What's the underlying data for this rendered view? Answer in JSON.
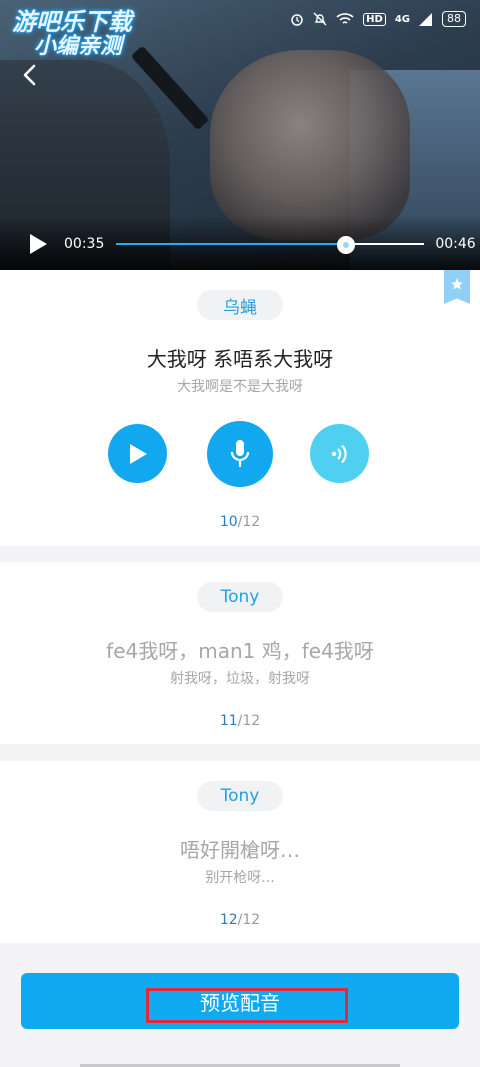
{
  "watermark": {
    "line1": "游吧乐下载",
    "line2": "小编亲测"
  },
  "status": {
    "hd": "HD",
    "network": "4G",
    "battery": "88"
  },
  "video": {
    "current_time": "00:35",
    "total_time": "00:46",
    "progress": 0.746
  },
  "lines": [
    {
      "role": "乌蝇",
      "text": "大我呀 系唔系大我呀",
      "translation": "大我啊是不是大我呀",
      "index": "10",
      "total": "/12"
    },
    {
      "role": "Tony",
      "text": "fe4我呀，man1 鸡，fe4我呀",
      "translation": "射我呀，垃圾，射我呀",
      "index": "11",
      "total": "/12"
    },
    {
      "role": "Tony",
      "text": "唔好開槍呀…",
      "translation": "别开枪呀...",
      "index": "12",
      "total": "/12"
    }
  ],
  "preview_button": {
    "label": "预览配音"
  },
  "colors": {
    "accent": "#10aaf2",
    "listen": "#4fd0f0",
    "highlight": "#e0293c"
  },
  "icons": {
    "back": "chevron-left-icon",
    "play": "play-icon",
    "record": "microphone-icon",
    "listen": "playback-sound-icon",
    "favorite": "star-icon"
  }
}
